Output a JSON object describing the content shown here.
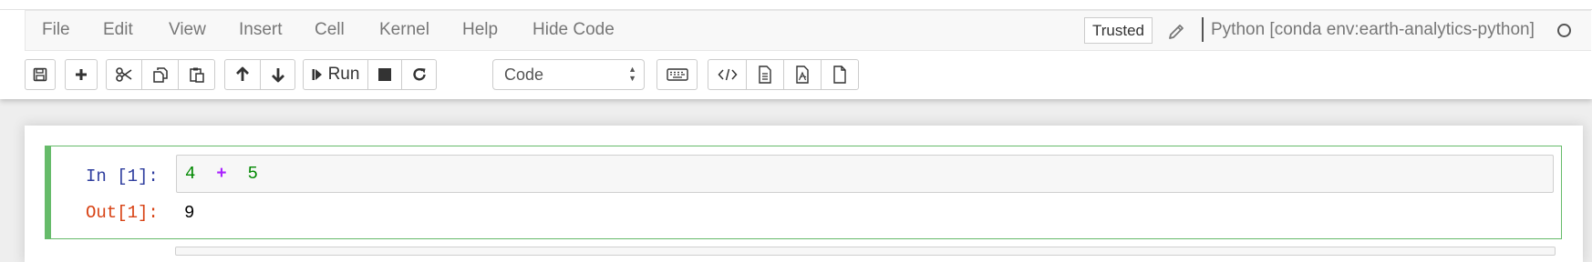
{
  "menubar": {
    "items": [
      {
        "label": "File"
      },
      {
        "label": "Edit"
      },
      {
        "label": "View"
      },
      {
        "label": "Insert"
      },
      {
        "label": "Cell"
      },
      {
        "label": "Kernel"
      },
      {
        "label": "Help"
      },
      {
        "label": "Hide Code"
      }
    ],
    "trusted_label": "Trusted",
    "kernel_name": "Python [conda env:earth-analytics-python]",
    "kernel_status": "idle"
  },
  "toolbar": {
    "buttons": [
      {
        "icon": "save-icon"
      },
      {
        "icon": "plus-icon"
      },
      {
        "icon": "scissors-icon"
      },
      {
        "icon": "copy-icon"
      },
      {
        "icon": "paste-icon"
      },
      {
        "icon": "arrow-up-icon"
      },
      {
        "icon": "arrow-down-icon"
      },
      {
        "icon": "step-forward-icon",
        "label": "Run"
      },
      {
        "icon": "stop-icon"
      },
      {
        "icon": "refresh-icon"
      },
      {
        "icon": "keyboard-icon"
      },
      {
        "icon": "code-icon"
      },
      {
        "icon": "file-text-icon"
      },
      {
        "icon": "file-pdf-icon"
      },
      {
        "icon": "file-icon"
      }
    ],
    "run_label": "Run",
    "cell_type": {
      "selected": "Code"
    }
  },
  "cell": {
    "in_prompt": "In [1]:",
    "code_tokens": [
      "4",
      "+",
      "5"
    ],
    "out_prompt": "Out[1]:",
    "output": "9"
  },
  "colors": {
    "selected_cell": "#66bb6a",
    "in_prompt": "#303f9f",
    "out_prompt": "#d84315",
    "number_token": "#008800",
    "operator_token": "#aa22ff"
  }
}
